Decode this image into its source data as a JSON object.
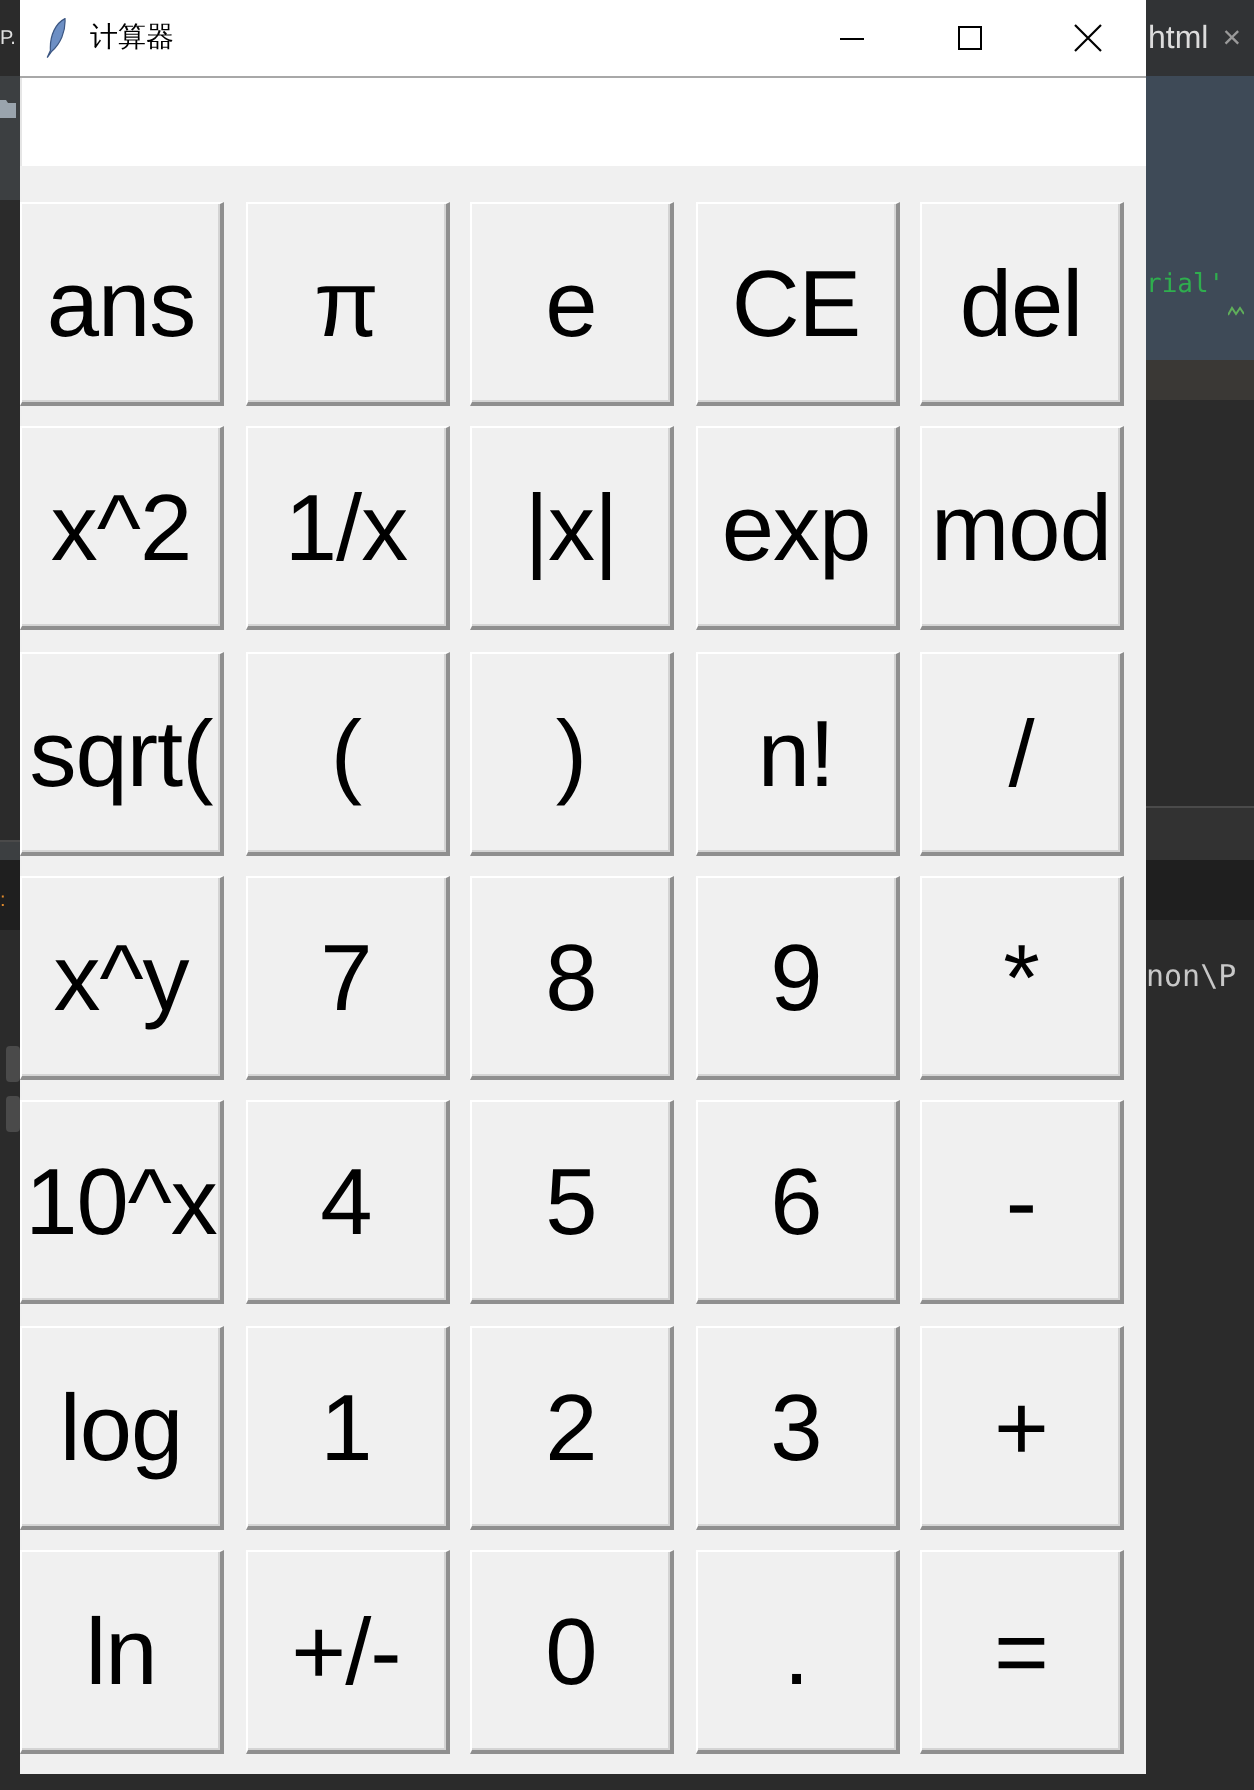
{
  "background_editor": {
    "left_tab_title": "P.",
    "tab_title": "html",
    "tab_close": "×",
    "code_fragment": "rial'",
    "gutter_mark": ":",
    "terminal_fragment": "non\\P"
  },
  "window": {
    "title": "计算器"
  },
  "keypad": {
    "rows": [
      [
        "ans",
        "π",
        "e",
        "CE",
        "del"
      ],
      [
        "x^2",
        "1/x",
        "|x|",
        "exp",
        "mod"
      ],
      [
        "sqrt(",
        "(",
        ")",
        "n!",
        "/"
      ],
      [
        "x^y",
        "7",
        "8",
        "9",
        "*"
      ],
      [
        "10^x",
        "4",
        "5",
        "6",
        "-"
      ],
      [
        "log",
        "1",
        "2",
        "3",
        "+"
      ],
      [
        "ln",
        "+/-",
        "0",
        ".",
        "="
      ]
    ]
  }
}
